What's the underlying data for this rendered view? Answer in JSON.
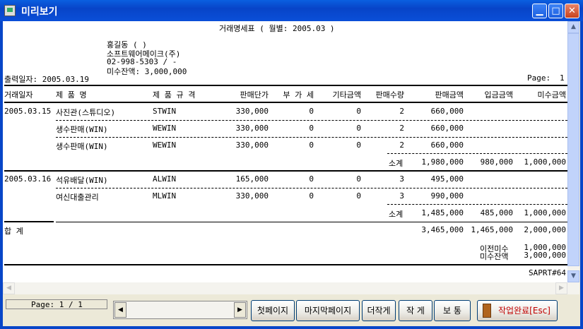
{
  "window": {
    "title": "미리보기"
  },
  "report": {
    "title": "거래명세표 ( 월별: 2005.03 )",
    "customer": {
      "name": "홍길동 (   )",
      "company": "소프트웨어메이크(주)",
      "phone": "02-998-5303 / -",
      "balance_label": "미수잔액: 3,000,000"
    },
    "print_date": "출력일자: 2005.03.19",
    "page_label": "Page:",
    "page_number": "1",
    "columns": [
      "거래일자",
      "제    품    명",
      "제  품  규  격",
      "판매단가",
      "부 가 세",
      "기타금액",
      "판매수량",
      "판매금액",
      "입금금액",
      "미수금액"
    ],
    "groups": [
      {
        "date": "2005.03.15",
        "rows": [
          {
            "product": "사진관(스튜디오)",
            "spec": "STWIN",
            "price": "330,000",
            "vat": "0",
            "etc": "0",
            "qty": "2",
            "sales": "660,000"
          },
          {
            "product": "생수판매(WIN)",
            "spec": "WEWIN",
            "price": "330,000",
            "vat": "0",
            "etc": "0",
            "qty": "2",
            "sales": "660,000"
          },
          {
            "product": "생수판매(WIN)",
            "spec": "WEWIN",
            "price": "330,000",
            "vat": "0",
            "etc": "0",
            "qty": "2",
            "sales": "660,000"
          }
        ],
        "subtotal": {
          "label": "소계",
          "sales": "1,980,000",
          "paid": "980,000",
          "unpaid": "1,000,000"
        }
      },
      {
        "date": "2005.03.16",
        "rows": [
          {
            "product": "석유배달(WIN)",
            "spec": "ALWIN",
            "price": "165,000",
            "vat": "0",
            "etc": "0",
            "qty": "3",
            "sales": "495,000"
          },
          {
            "product": "여신대출관리",
            "spec": "MLWIN",
            "price": "330,000",
            "vat": "0",
            "etc": "0",
            "qty": "3",
            "sales": "990,000"
          }
        ],
        "subtotal": {
          "label": "소계",
          "sales": "1,485,000",
          "paid": "485,000",
          "unpaid": "1,000,000"
        }
      }
    ],
    "total": {
      "label": "합    계",
      "sales": "3,465,000",
      "paid": "1,465,000",
      "unpaid": "2,000,000"
    },
    "summary": {
      "prev_label": "이전미수",
      "prev_value": "1,000,000",
      "balance_label": "미수잔액",
      "balance_value": "3,000,000"
    },
    "footer_code": "SAPRT#64"
  },
  "statusbar": {
    "page_info": "Page:  1 / 1",
    "buttons": {
      "first": "첫페이지",
      "last": "마지막페이지",
      "smaller": "더작게",
      "small": "작 게",
      "normal": "보 통",
      "done": "작업완료[Esc]"
    }
  }
}
